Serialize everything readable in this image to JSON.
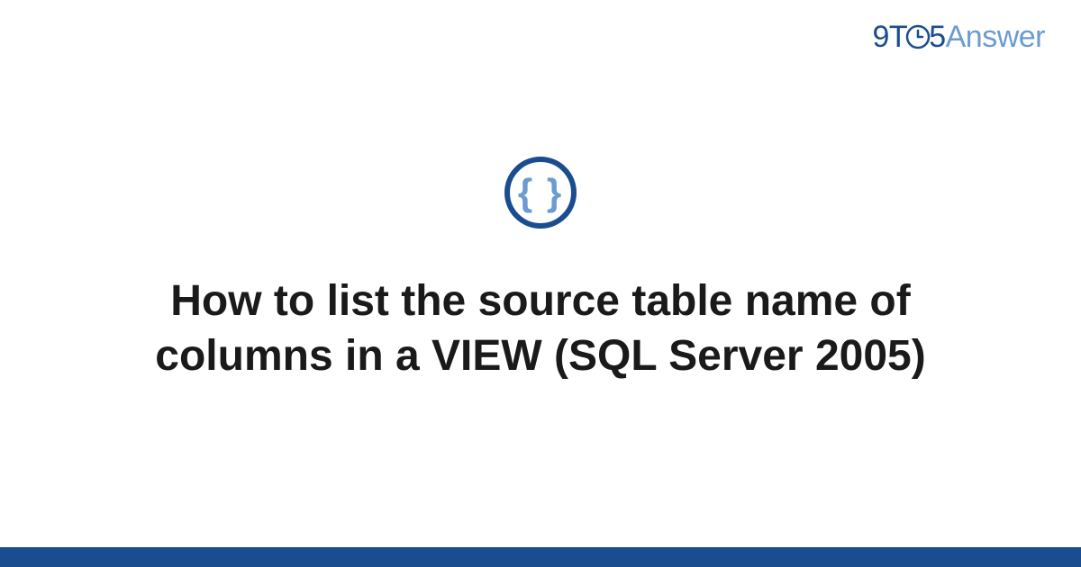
{
  "brand": {
    "prefix": "9T",
    "middle": "5",
    "suffix": "Answer"
  },
  "icon": {
    "symbol": "{ }",
    "name": "code-braces"
  },
  "title": "How to list the source table name of columns in a VIEW (SQL Server 2005)",
  "colors": {
    "primary": "#1a4d8f",
    "secondary": "#6b9bd1",
    "text": "#1a1a1a",
    "background": "#ffffff"
  }
}
